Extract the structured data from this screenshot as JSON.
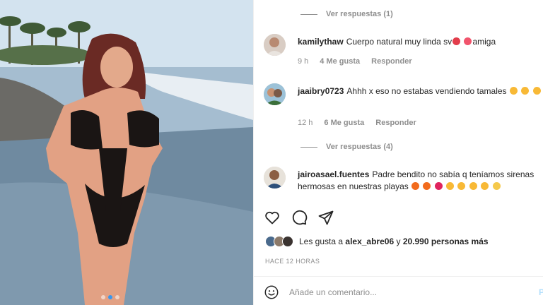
{
  "colors": {
    "accent": "#3897f0",
    "muted": "#8e8e8e",
    "text": "#262626",
    "post_disabled": "#b2dffc"
  },
  "photo": {
    "carousel": {
      "count": 3,
      "active": 2
    }
  },
  "comments": {
    "view_replies_top": "Ver respuestas (1)",
    "items": [
      {
        "username": "kamilythaw",
        "text": "Cuerpo natural muy linda sv",
        "text_after": "amiga",
        "time": "9 h",
        "likes": "4 Me gusta",
        "reply": "Responder"
      },
      {
        "username": "jaaibry0723",
        "text": "Ahhh x eso no estabas vendiendo tamales",
        "time": "12 h",
        "likes": "6 Me gusta",
        "reply": "Responder",
        "view_replies": "Ver respuestas (4)"
      },
      {
        "username": "jairoasael.fuentes",
        "text": "Padre bendito no sabía q teníamos sirenas hermosas en nuestras playas"
      }
    ]
  },
  "actions": {
    "like_icon": "heart-icon",
    "comment_icon": "comment-icon",
    "share_icon": "paper-plane-icon"
  },
  "likes": {
    "prefix": "Les gusta a",
    "user": "alex_abre06",
    "conj": "y",
    "count": "20.990 personas más"
  },
  "timestamp": "HACE 12 HORAS",
  "add_comment": {
    "placeholder": "Añade un comentario...",
    "post_label": "P"
  }
}
